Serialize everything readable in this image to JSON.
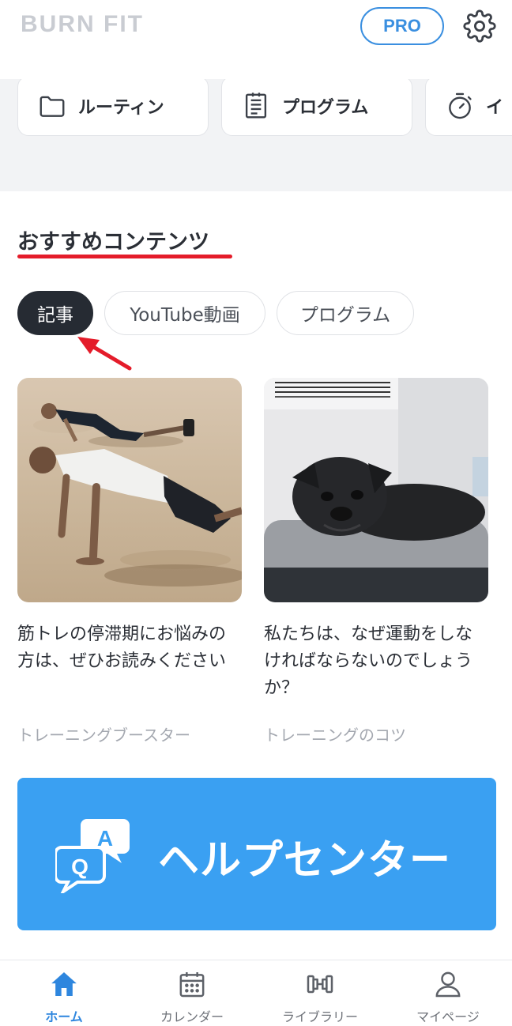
{
  "header": {
    "logo_text": "BURN FIT",
    "pro_label": "PRO",
    "settings_icon": "gear-icon"
  },
  "quick_links": [
    {
      "label": "ルーティン",
      "icon": "folder-icon"
    },
    {
      "label": "プログラム",
      "icon": "clipboard-list-icon"
    },
    {
      "label": "イ",
      "icon": "stopwatch-icon"
    }
  ],
  "featured": {
    "title": "おすすめコンテンツ",
    "tabs": [
      {
        "label": "記事",
        "active": true
      },
      {
        "label": "YouTube動画",
        "active": false
      },
      {
        "label": "プログラム",
        "active": false
      }
    ],
    "articles": [
      {
        "title": "筋トレの停滞期にお悩みの方は、ぜひお読みください",
        "category": "トレーニングブースター",
        "image": "push-up-beach-photo"
      },
      {
        "title": "私たちは、なぜ運動をしなければならないのでしょうか？",
        "category": "トレーニングのコツ",
        "image": "black-pug-photo"
      }
    ]
  },
  "help_banner": {
    "label": "ヘルプセンター",
    "icon_q": "Q",
    "icon_a": "A"
  },
  "bottom_nav": [
    {
      "label": "ホーム",
      "icon": "home-icon",
      "active": true
    },
    {
      "label": "カレンダー",
      "icon": "calendar-icon",
      "active": false
    },
    {
      "label": "ライブラリー",
      "icon": "dumbbell-icon",
      "active": false
    },
    {
      "label": "マイページ",
      "icon": "person-icon",
      "active": false
    }
  ],
  "colors": {
    "accent": "#3a8fe0",
    "help_banner": "#3aa0f2",
    "underline": "#e41c2a",
    "active_chip": "#262b33"
  }
}
